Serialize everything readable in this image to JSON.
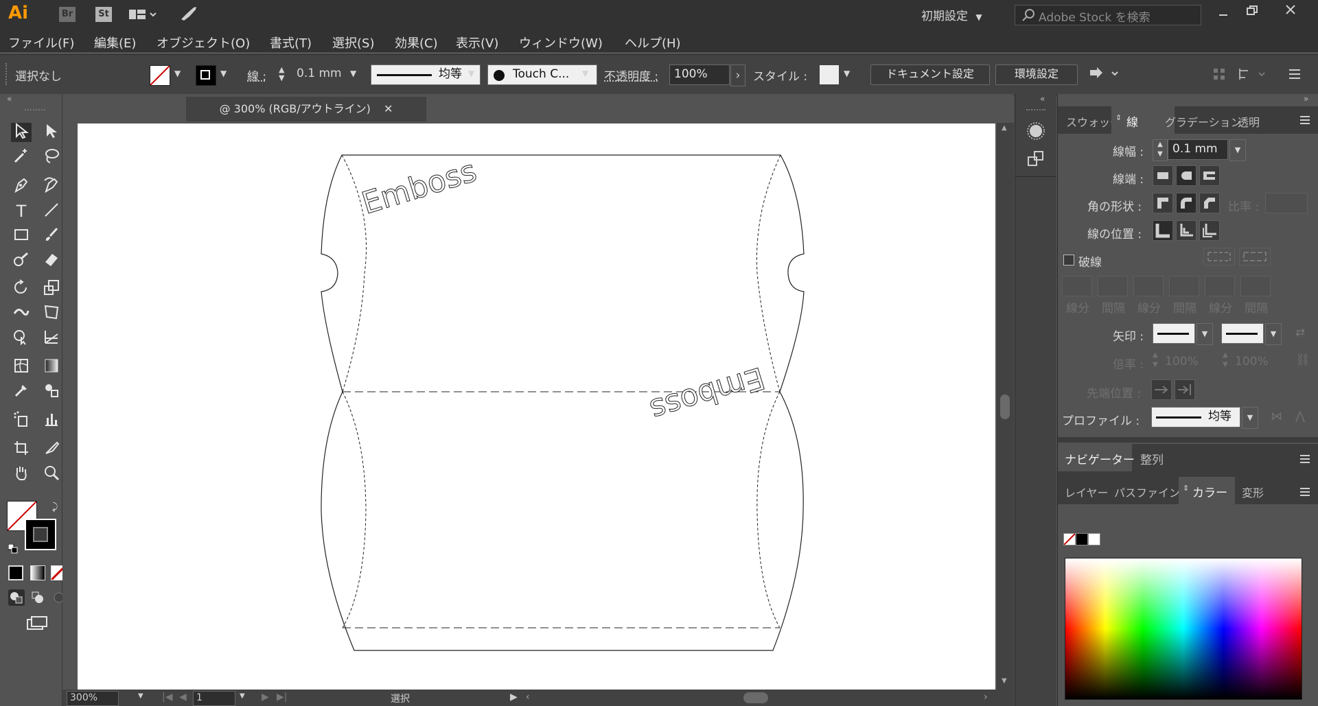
{
  "app": {
    "logo": "Ai",
    "br": "Br",
    "st": "St"
  },
  "titlebar": {
    "workspace": "初期設定",
    "search_placeholder": "Adobe Stock を検索"
  },
  "menu": [
    "ファイル(F)",
    "編集(E)",
    "オブジェクト(O)",
    "書式(T)",
    "選択(S)",
    "効果(C)",
    "表示(V)",
    "ウィンドウ(W)",
    "ヘルプ(H)"
  ],
  "control": {
    "selection": "選択なし",
    "stroke_label": "線 :",
    "stroke_value": "0.1 mm",
    "profile": "均等",
    "brush": "Touch C...",
    "opacity_label": "不透明度 :",
    "opacity_value": "100%",
    "style_label": "スタイル :",
    "doc_settings": "ドキュメント設定",
    "prefs": "環境設定"
  },
  "document": {
    "tab_title": "@ 300% (RGB/アウトライン)"
  },
  "artwork": {
    "text_top": "Emboss",
    "text_bottom": "Emboss"
  },
  "status": {
    "zoom": "300%",
    "artboard": "1",
    "tool": "選択"
  },
  "stroke_panel": {
    "tabs": [
      "スウォッチ",
      "線",
      "グラデーション",
      "透明"
    ],
    "weight_label": "線幅 :",
    "weight_value": "0.1 mm",
    "cap_label": "線端 :",
    "corner_label": "角の形状 :",
    "limit_label": "比率 :",
    "align_label": "線の位置 :",
    "dashed_label": "破線",
    "dash_labels": [
      "線分",
      "間隔",
      "線分",
      "間隔",
      "線分",
      "間隔"
    ],
    "arrow_label": "矢印 :",
    "scale_label": "倍率 :",
    "scale_values": [
      "100%",
      "100%"
    ],
    "tip_label": "先端位置 :",
    "profile_label": "プロファイル :",
    "profile_value": "均等"
  },
  "nav_panel": {
    "tabs": [
      "ナビゲーター",
      "整列"
    ]
  },
  "color_panel": {
    "tabs": [
      "レイヤー",
      "パスファインダ",
      "カラー",
      "変形"
    ]
  },
  "colors": {
    "accent": "#ff9a00",
    "stroke_none": "#cc0000"
  }
}
